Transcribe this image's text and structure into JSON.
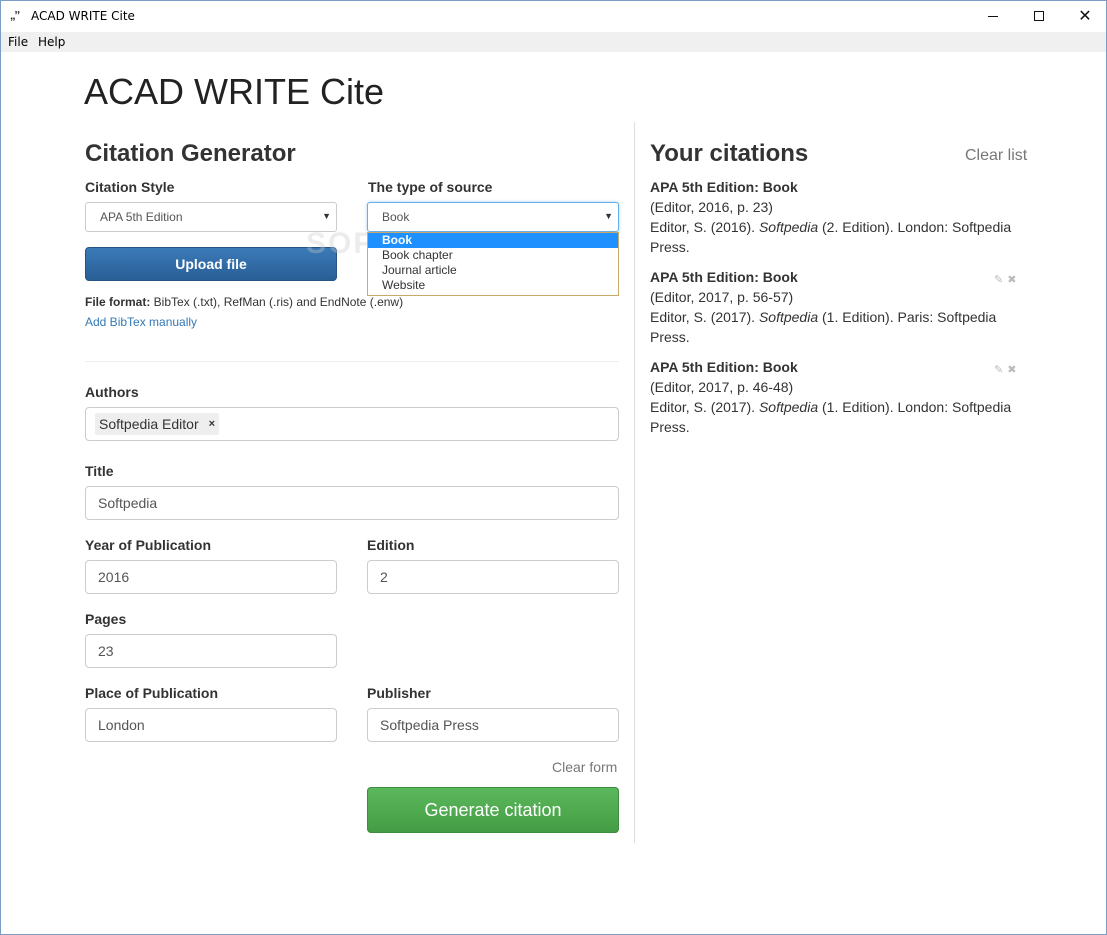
{
  "window": {
    "icon": "„ˮ",
    "title": "ACAD WRITE Cite"
  },
  "menu": {
    "file": "File",
    "help": "Help"
  },
  "app_title": "ACAD WRITE Cite",
  "generator": {
    "heading": "Citation Generator",
    "style_label": "Citation Style",
    "style_value": "APA 5th Edition",
    "source_label": "The type of source",
    "source_value": "Book",
    "source_options": [
      "Book",
      "Book chapter",
      "Journal article",
      "Website"
    ],
    "upload_label": "Upload file",
    "file_format_label": "File format:",
    "file_format_text": " BibTex (.txt), RefMan (.ris) and EndNote (.enw)",
    "add_bibtex": "Add BibTex manually",
    "watermark": "SOFTPEDIA"
  },
  "form": {
    "authors_label": "Authors",
    "author_tag": "Softpedia Editor",
    "title_label": "Title",
    "title_value": "Softpedia",
    "year_label": "Year of Publication",
    "year_value": "2016",
    "edition_label": "Edition",
    "edition_value": "2",
    "pages_label": "Pages",
    "pages_value": "23",
    "place_label": "Place of Publication",
    "place_value": "London",
    "publisher_label": "Publisher",
    "publisher_value": "Softpedia Press",
    "clear_form": "Clear form",
    "generate": "Generate citation"
  },
  "citations": {
    "heading": "Your citations",
    "clear_list": "Clear list",
    "items": [
      {
        "title": "APA 5th Edition: Book",
        "intext": "(Editor, 2016, p. 23)",
        "ref_pre": "Editor, S. (2016). ",
        "ref_italic": "Softpedia",
        "ref_post": " (2. Edition). London: Softpedia Press."
      },
      {
        "title": "APA 5th Edition: Book",
        "intext": "(Editor, 2017, p. 56-57)",
        "ref_pre": "Editor, S. (2017). ",
        "ref_italic": "Softpedia",
        "ref_post": " (1. Edition). Paris: Softpedia Press."
      },
      {
        "title": "APA 5th Edition: Book",
        "intext": "(Editor, 2017, p. 46-48)",
        "ref_pre": "Editor, S. (2017). ",
        "ref_italic": "Softpedia",
        "ref_post": " (1. Edition). London: Softpedia Press."
      }
    ]
  },
  "icons": {
    "minimize": "—",
    "close": "✕",
    "arrow": "▼",
    "tag_remove": "×",
    "edit": "✎",
    "delete": "✖"
  }
}
